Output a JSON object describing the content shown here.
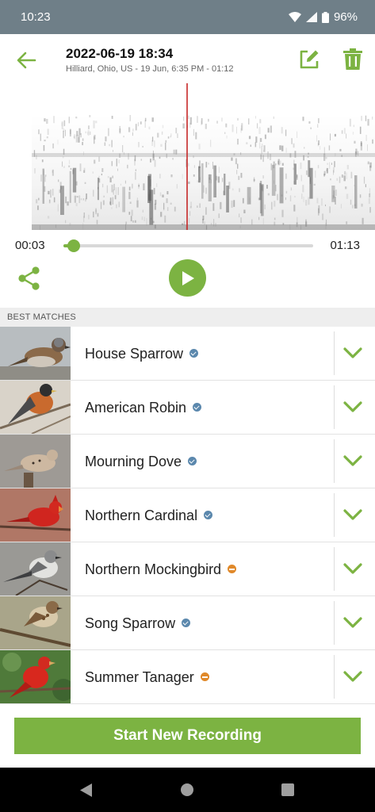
{
  "status_bar": {
    "time": "10:23",
    "battery": "96%",
    "icons": [
      "wifi-icon",
      "signal-icon",
      "battery-icon"
    ]
  },
  "header": {
    "title": "2022-06-19 18:34",
    "subtitle": "Hilliard, Ohio, US - 19 Jun, 6:35 PM - 01:12",
    "back_icon": "arrow-left-icon",
    "edit_icon": "edit-icon",
    "delete_icon": "trash-icon"
  },
  "playback": {
    "current_time": "00:03",
    "total_time": "01:13",
    "progress_fraction": 0.04,
    "share_icon": "share-icon",
    "play_icon": "play-icon"
  },
  "matches_section": {
    "label": "BEST MATCHES",
    "items": [
      {
        "name": "House Sparrow",
        "status": "verified"
      },
      {
        "name": "American Robin",
        "status": "verified"
      },
      {
        "name": "Mourning Dove",
        "status": "verified"
      },
      {
        "name": "Northern Cardinal",
        "status": "verified"
      },
      {
        "name": "Northern Mockingbird",
        "status": "partial"
      },
      {
        "name": "Song Sparrow",
        "status": "verified"
      },
      {
        "name": "Summer Tanager",
        "status": "partial"
      }
    ]
  },
  "footer": {
    "start_label": "Start New Recording"
  },
  "colors": {
    "accent": "#7cb342",
    "status_bar": "#6f7f88",
    "playhead": "#c62828",
    "verified": "#5b88ad",
    "partial": "#e0892a"
  }
}
